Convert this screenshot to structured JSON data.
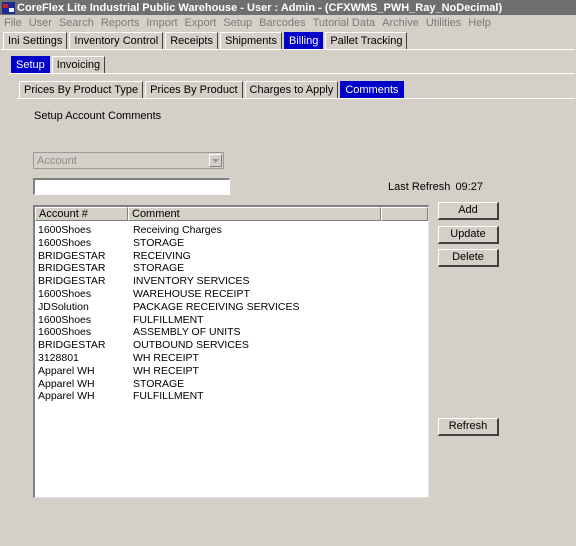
{
  "window": {
    "title": "CoreFlex Lite Industrial Public Warehouse - User : Admin - (CFXWMS_PWH_Ray_NoDecimal)"
  },
  "menu": [
    {
      "label": "File"
    },
    {
      "label": "User"
    },
    {
      "label": "Search"
    },
    {
      "label": "Reports"
    },
    {
      "label": "Import"
    },
    {
      "label": "Export"
    },
    {
      "label": "Setup"
    },
    {
      "label": "Barcodes"
    },
    {
      "label": "Tutorial Data"
    },
    {
      "label": "Archive"
    },
    {
      "label": "Utilities"
    },
    {
      "label": "Help"
    }
  ],
  "main_tabs": [
    {
      "label": "Ini Settings",
      "active": false
    },
    {
      "label": "Inventory Control",
      "active": false
    },
    {
      "label": "Receipts",
      "active": false
    },
    {
      "label": "Shipments",
      "active": false
    },
    {
      "label": "Billing",
      "active": true
    },
    {
      "label": "Pallet Tracking",
      "active": false
    }
  ],
  "sub_tabs": [
    {
      "label": "Setup",
      "active": true
    },
    {
      "label": "Invoicing",
      "active": false
    }
  ],
  "inner_tabs": [
    {
      "label": "Prices By Product Type",
      "active": false
    },
    {
      "label": "Prices By Product",
      "active": false
    },
    {
      "label": "Charges to Apply",
      "active": false
    },
    {
      "label": "Comments",
      "active": true
    }
  ],
  "section_title": "Setup Account Comments",
  "account_combo": {
    "value": "Account",
    "enabled": false
  },
  "text_input": {
    "value": "",
    "placeholder": ""
  },
  "last_refresh": {
    "label": "Last Refresh",
    "time": "09:27"
  },
  "grid": {
    "columns": [
      "Account #",
      "Comment"
    ],
    "rows": [
      [
        "1600Shoes",
        "Receiving Charges"
      ],
      [
        "1600Shoes",
        "STORAGE"
      ],
      [
        "BRIDGESTAR",
        "RECEIVING"
      ],
      [
        "BRIDGESTAR",
        "STORAGE"
      ],
      [
        "BRIDGESTAR",
        "INVENTORY SERVICES"
      ],
      [
        "1600Shoes",
        "WAREHOUSE RECEIPT"
      ],
      [
        "JDSolution",
        "PACKAGE RECEIVING SERVICES"
      ],
      [
        "1600Shoes",
        "FULFILLMENT"
      ],
      [
        "1600Shoes",
        "ASSEMBLY OF UNITS"
      ],
      [
        "BRIDGESTAR",
        "OUTBOUND SERVICES"
      ],
      [
        "3128801",
        "WH RECEIPT"
      ],
      [
        "Apparel WH",
        "WH RECEIPT"
      ],
      [
        "Apparel WH",
        "STORAGE"
      ],
      [
        "Apparel WH",
        "FULFILLMENT"
      ]
    ]
  },
  "buttons": {
    "add": "Add",
    "update": "Update",
    "delete": "Delete",
    "refresh": "Refresh"
  },
  "colors": {
    "active_tab": "#0000c8",
    "window_bg": "#d4d0c8",
    "titlebar_bg": "#6f6f6f"
  },
  "icons": {
    "app": "app-icon",
    "combo_arrow": "chevron-down-icon"
  }
}
